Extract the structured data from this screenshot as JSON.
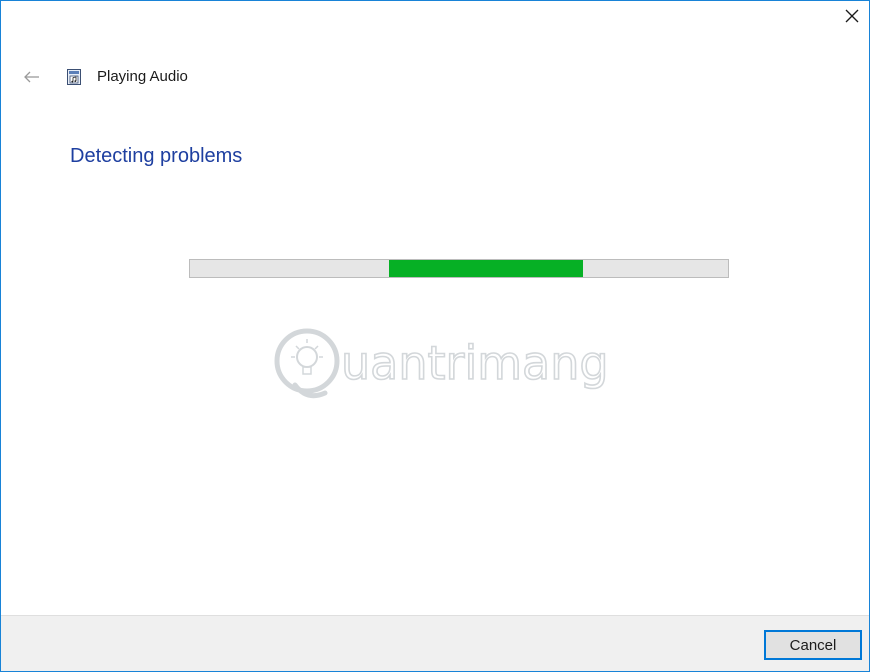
{
  "window": {
    "title": "Playing Audio",
    "close_icon": "close-icon",
    "back_icon": "back-arrow-icon",
    "app_icon": "troubleshooter-icon"
  },
  "main": {
    "heading": "Detecting problems",
    "progress": {
      "type": "indeterminate",
      "fill_start": 0.37,
      "fill_end": 0.73,
      "fill_color": "#06b025",
      "track_color": "#e6e6e6"
    },
    "watermark": {
      "text": "uantrimang",
      "icon": "lightbulb-logo-icon"
    }
  },
  "footer": {
    "cancel_label": "Cancel"
  },
  "colors": {
    "accent": "#0078d7",
    "heading": "#1e3fa0",
    "border": "#1883d7"
  }
}
